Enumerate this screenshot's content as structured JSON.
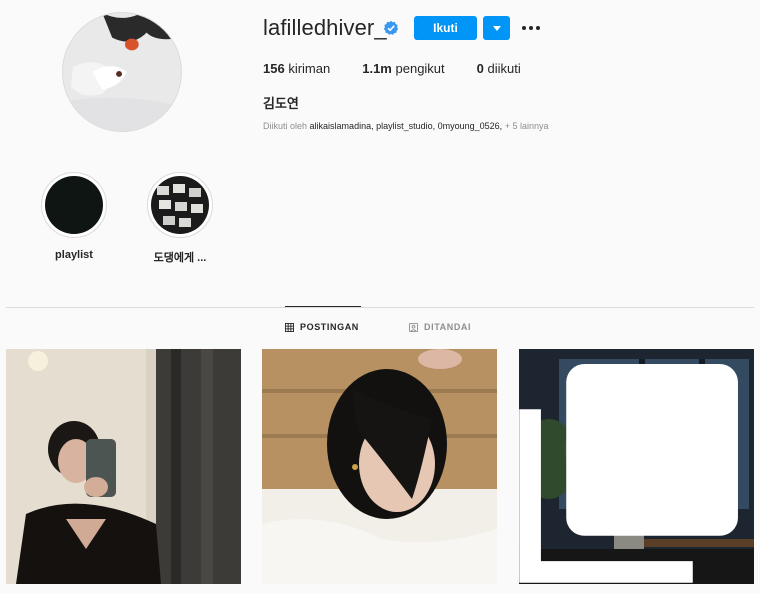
{
  "profile": {
    "username": "lafilledhiver_",
    "verified": true,
    "follow_label": "Ikuti",
    "stats": [
      {
        "value": "156",
        "label": "kiriman"
      },
      {
        "value": "1.1m",
        "label": "pengikut"
      },
      {
        "value": "0",
        "label": "diikuti"
      }
    ],
    "full_name": "김도연",
    "followed_by_prefix": "Diikuti oleh",
    "followed_by_names": "alikaislamadina, playlist_studio, 0myoung_0526,",
    "followed_by_more": "+ 5 lainnya"
  },
  "highlights": [
    {
      "label": "playlist"
    },
    {
      "label": "도댕에게 ..."
    }
  ],
  "tabs": {
    "posts": "POSTINGAN",
    "tagged": "DITANDAI"
  },
  "colors": {
    "accent": "#0095f6",
    "verified": "#3897f0",
    "background": "#fafafa"
  },
  "icons": [
    "verified-badge-icon",
    "chevron-down-icon",
    "more-options-icon",
    "grid-icon",
    "tagged-icon",
    "multiple-photos-icon"
  ]
}
